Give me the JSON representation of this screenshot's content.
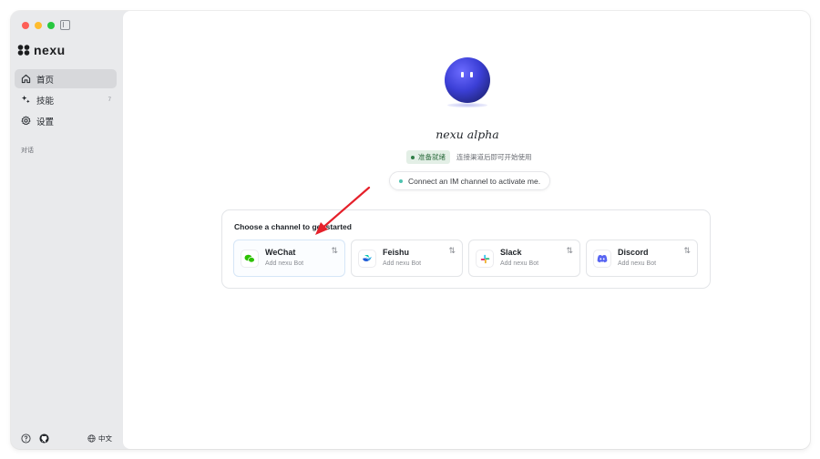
{
  "brand": {
    "name": "nexu"
  },
  "nav": [
    {
      "label": "首页",
      "icon": "home-icon",
      "active": true,
      "badge": ""
    },
    {
      "label": "技能",
      "icon": "sparkle-icon",
      "active": false,
      "badge": "7"
    },
    {
      "label": "设置",
      "icon": "gear-icon",
      "active": false,
      "badge": ""
    }
  ],
  "sidebar": {
    "section_label": "对话",
    "lang": "中文"
  },
  "agent": {
    "name": "nexu alpha",
    "status": "准备就绪",
    "status_hint": "连接渠道后即可开始使用",
    "connect_hint": "Connect an IM channel to activate me."
  },
  "channels": {
    "title": "Choose a channel to get started",
    "items": [
      {
        "name": "WeChat",
        "sub": "Add nexu Bot",
        "icon": "wechat-icon",
        "color": "#2dc100"
      },
      {
        "name": "Feishu",
        "sub": "Add nexu Bot",
        "icon": "feishu-icon",
        "color": "#1f5bd8"
      },
      {
        "name": "Slack",
        "sub": "Add nexu Bot",
        "icon": "slack-icon",
        "color": "#e01e5a"
      },
      {
        "name": "Discord",
        "sub": "Add nexu Bot",
        "icon": "discord-icon",
        "color": "#5865f2"
      }
    ]
  },
  "colors": {
    "accent": "#2f6d40",
    "annotation": "#e5202a"
  }
}
